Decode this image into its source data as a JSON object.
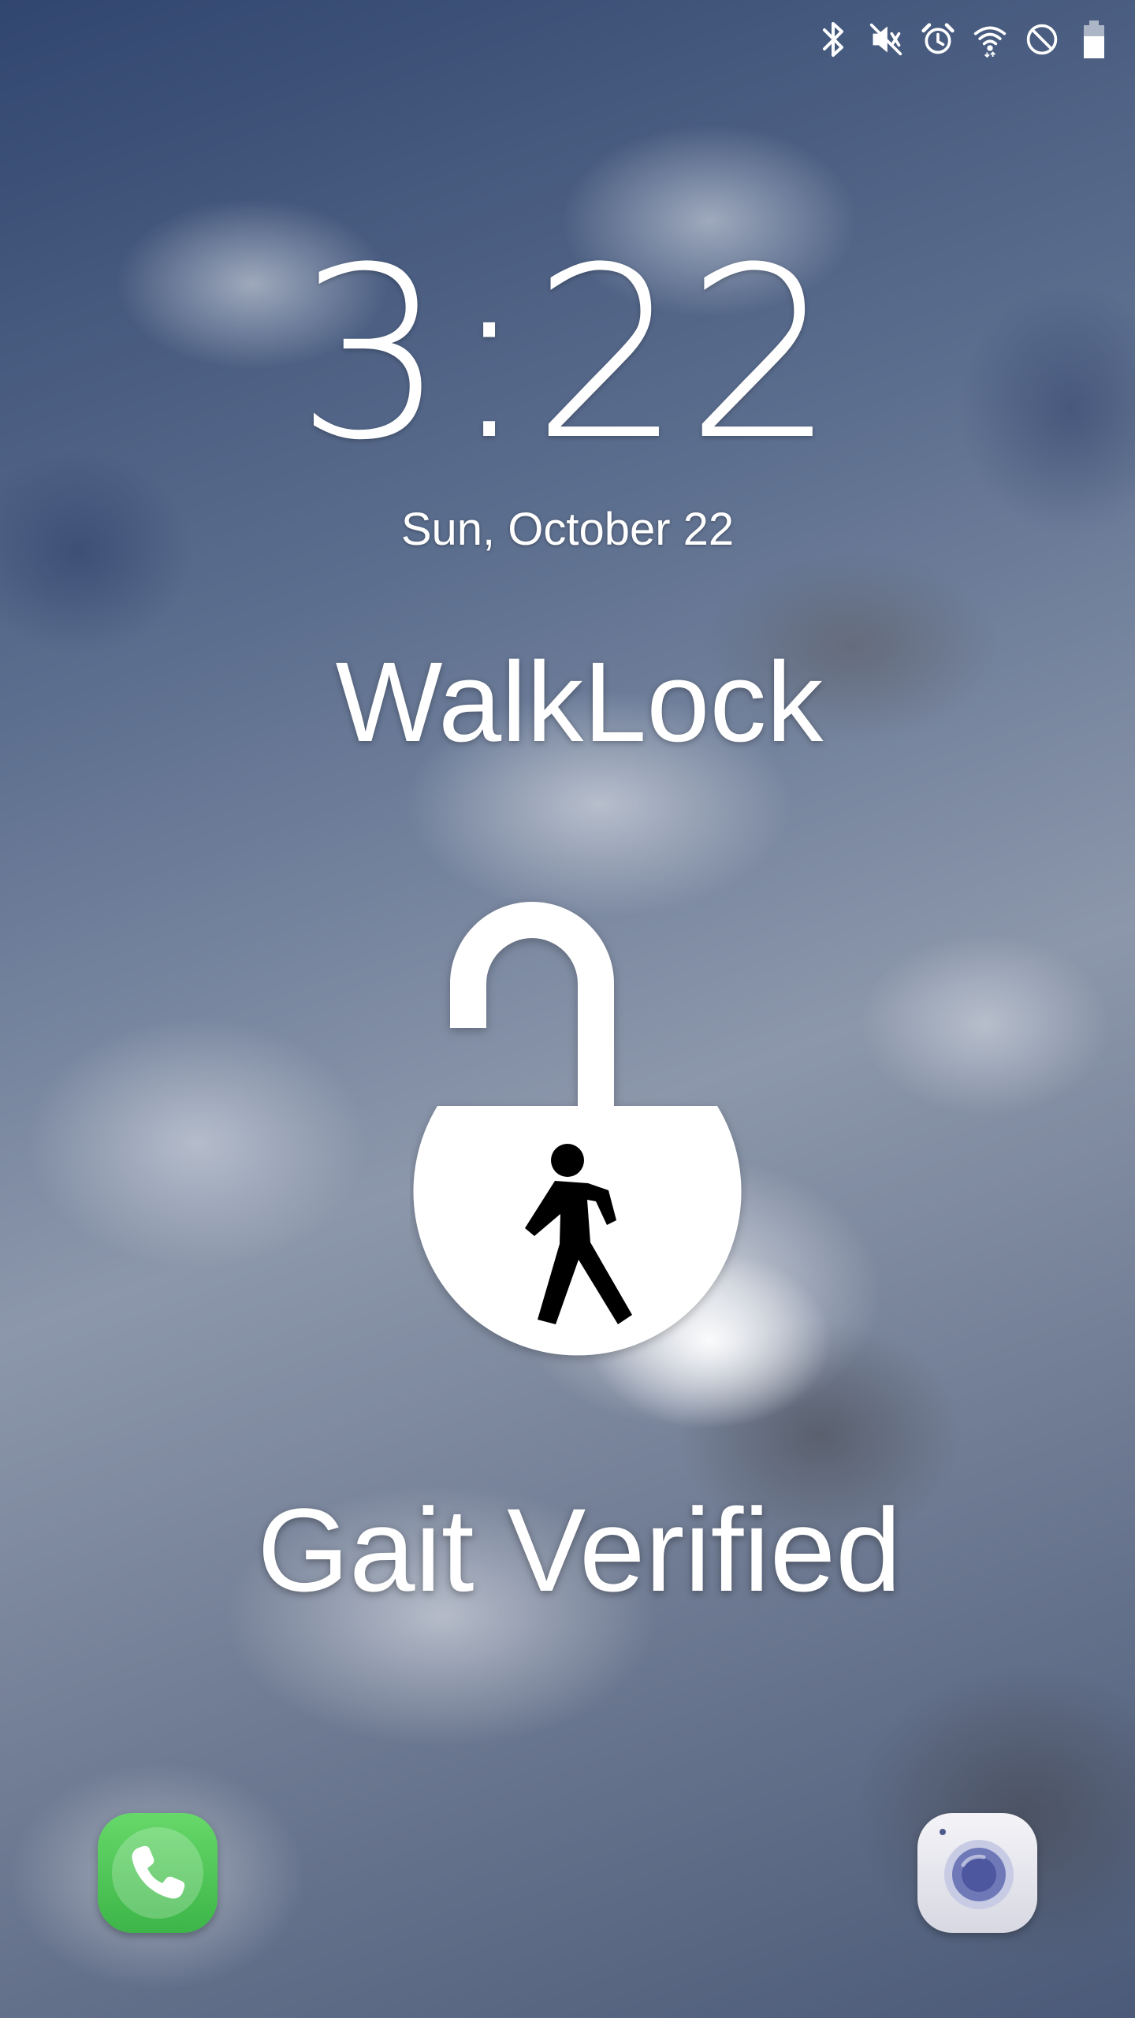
{
  "status_bar": {
    "icons": [
      "bluetooth-icon",
      "vibrate-mute-icon",
      "alarm-icon",
      "wifi-icon",
      "do-not-disturb-icon",
      "battery-icon"
    ]
  },
  "lock_screen": {
    "time": "3:22",
    "date": "Sun, October 22",
    "app_name": "WalkLock",
    "status_message": "Gait Verified",
    "lock_state_icon": "unlocked-padlock-walking-person-icon"
  },
  "shortcuts": {
    "left": {
      "icon": "phone-icon",
      "color": "#4cc556"
    },
    "right": {
      "icon": "camera-icon",
      "color": "#e6e6ee"
    }
  },
  "colors": {
    "text": "#ffffff",
    "padlock": "#ffffff",
    "walker": "#000000"
  }
}
